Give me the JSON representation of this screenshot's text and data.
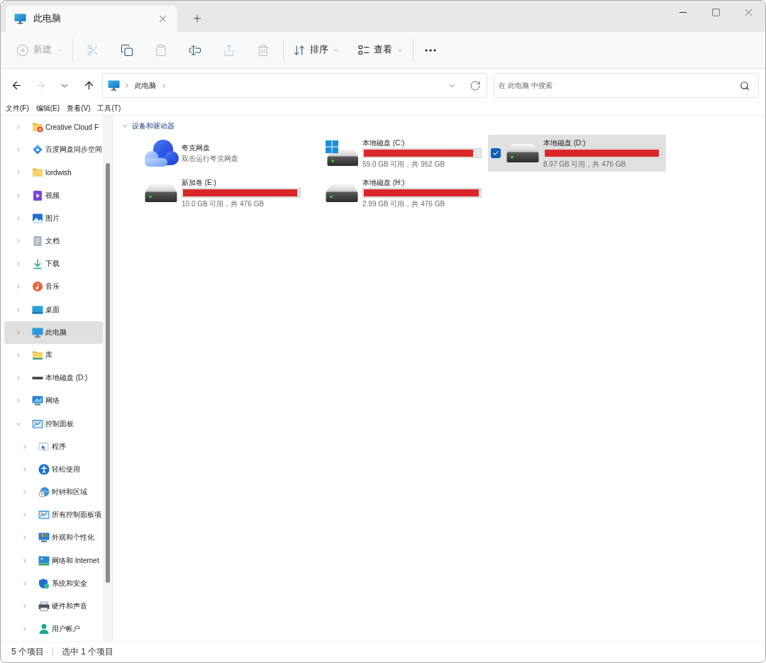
{
  "tabs": [
    {
      "label": "此电脑",
      "selected": true
    }
  ],
  "toolbar": {
    "groups": [
      {
        "items": [
          {
            "kind": "new",
            "label": "新建",
            "disabled": true
          }
        ]
      },
      {
        "items": [
          {
            "kind": "cut",
            "disabled": true
          },
          {
            "kind": "copy",
            "disabled": false
          },
          {
            "kind": "paste",
            "disabled": true
          },
          {
            "kind": "rename",
            "disabled": false
          },
          {
            "kind": "share",
            "disabled": true
          },
          {
            "kind": "delete",
            "disabled": true
          }
        ]
      },
      {
        "items": [
          {
            "kind": "sort",
            "label": "排序",
            "disabled": false
          },
          {
            "kind": "view",
            "label": "查看",
            "disabled": false
          }
        ]
      },
      {
        "items": [
          {
            "kind": "more",
            "disabled": false
          }
        ]
      }
    ]
  },
  "navigation": [
    {
      "kind": "back",
      "disabled": false
    },
    {
      "kind": "forward",
      "disabled": true
    },
    {
      "kind": "recent",
      "disabled": false
    },
    {
      "kind": "up",
      "disabled": false
    }
  ],
  "address_bar": {
    "path": [
      "此电脑"
    ]
  },
  "search": {
    "placeholder": "在 此电脑 中搜索"
  },
  "menu_bar": [
    "文件(F)",
    "编辑(E)",
    "查看(V)",
    "工具(T)"
  ],
  "sidebar": {
    "items": [
      {
        "kind": "creative_cloud",
        "label": "Creative Cloud F",
        "selected": false,
        "expanded": false
      },
      {
        "kind": "baidu",
        "label": "百度网盘同步空间",
        "selected": false,
        "expanded": false
      },
      {
        "kind": "folder",
        "label": "lordwish",
        "selected": false,
        "expanded": false
      },
      {
        "kind": "videos",
        "label": "视频",
        "selected": false,
        "expanded": false
      },
      {
        "kind": "pictures",
        "label": "图片",
        "selected": false,
        "expanded": false
      },
      {
        "kind": "documents",
        "label": "文档",
        "selected": false,
        "expanded": false
      },
      {
        "kind": "downloads",
        "label": "下载",
        "selected": false,
        "expanded": false
      },
      {
        "kind": "music",
        "label": "音乐",
        "selected": false,
        "expanded": false
      },
      {
        "kind": "desktop",
        "label": "桌面",
        "selected": false,
        "expanded": false
      },
      {
        "kind": "this_pc",
        "label": "此电脑",
        "selected": true,
        "expanded": false
      },
      {
        "kind": "library",
        "label": "库",
        "selected": false,
        "expanded": false
      },
      {
        "kind": "local_drive",
        "label": "本地磁盘 (D:)",
        "selected": false,
        "expanded": false
      },
      {
        "kind": "network",
        "label": "网络",
        "selected": false,
        "expanded": false
      },
      {
        "kind": "control_panel",
        "label": "控制面板",
        "selected": false,
        "expanded": true,
        "children": [
          {
            "kind": "programs",
            "label": "程序",
            "selected": false,
            "expanded": false
          },
          {
            "kind": "accessibility",
            "label": "轻松使用",
            "selected": false,
            "expanded": false
          },
          {
            "kind": "clock_region",
            "label": "时钟和区域",
            "selected": false,
            "expanded": false
          },
          {
            "kind": "control_panel",
            "label": "所有控制面板项",
            "selected": false,
            "expanded": false
          },
          {
            "kind": "appearance",
            "label": "外观和个性化",
            "selected": false,
            "expanded": false
          },
          {
            "kind": "network_internet",
            "label": "网络和 Internet",
            "selected": false,
            "expanded": false
          },
          {
            "kind": "security",
            "label": "系统和安全",
            "selected": false,
            "expanded": false
          },
          {
            "kind": "hardware_sound",
            "label": "硬件和声音",
            "selected": false,
            "expanded": false
          },
          {
            "kind": "user_accounts",
            "label": "用户帐户",
            "selected": false,
            "expanded": false
          }
        ]
      }
    ]
  },
  "devices": {
    "title": "设备和驱动器",
    "expanded": true,
    "items": [
      {
        "kind": "cloud",
        "name": "夸克网盘",
        "subtitle": "双击运行夸克网盘",
        "selected": false
      },
      {
        "kind": "system_drive",
        "name": "本地磁盘 (C:)",
        "level": 0.94,
        "usage": "59.0 GB 可用，共 952 GB",
        "selected": false
      },
      {
        "kind": "drive",
        "name": "本地磁盘 (D:)",
        "level": 0.98,
        "usage": "8.97 GB 可用，共 476 GB",
        "selected": true
      },
      {
        "kind": "drive",
        "name": "新加卷 (E:)",
        "level": 0.98,
        "usage": "10.0 GB 可用，共 476 GB",
        "selected": false
      },
      {
        "kind": "drive",
        "name": "本地磁盘 (H:)",
        "level": 0.99,
        "usage": "2.99 GB 可用，共 476 GB",
        "selected": false
      }
    ]
  },
  "status_bar": {
    "item_count": "5 个项目",
    "selection": "选中 1 个项目"
  }
}
